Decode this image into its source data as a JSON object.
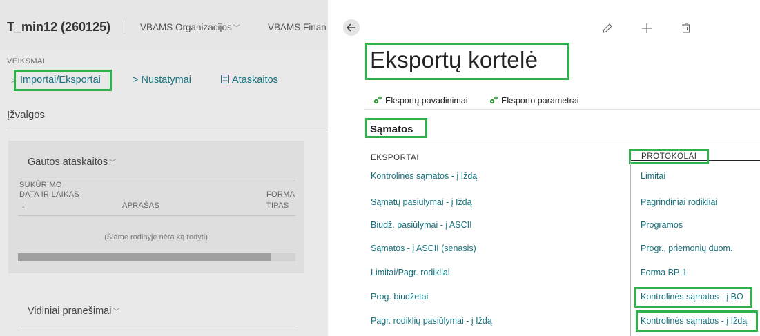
{
  "left_panel": {
    "app_title": "T_min12 (260125)",
    "nav": [
      {
        "label": "VBAMS Organizacijos",
        "icon": "chevron-down-icon"
      },
      {
        "label": "VBAMS Finan"
      }
    ],
    "actions_heading": "VEIKSMAI",
    "actions": [
      {
        "label": "Importai/Eksportai",
        "icon": "chevron-right-icon"
      },
      {
        "label": "> Nustatymai"
      },
      {
        "label": "Ataskaitos",
        "icon": "report-icon"
      }
    ],
    "insights_title": "Įžvalgos",
    "part_received": {
      "title": "Gautos ataskaitos",
      "columns": [
        "SUKŪRIMO",
        "DATA IR LAIKAS",
        "↓",
        "APRAŠAS",
        "FORMA",
        "TIPAS"
      ],
      "empty_message": "(Šiame rodinyje nėra ką rodyti)"
    },
    "part_internal": {
      "title": "Vidiniai pranešimai"
    }
  },
  "card": {
    "title": "Eksportų kortelė",
    "toolbar": {
      "names_label": "Eksportų pavadinimai",
      "params_label": "Eksporto parametrai"
    },
    "section_title": "Sąmatos",
    "exports_heading": "EKSPORTAI",
    "protocols_heading": "PROTOKOLAI",
    "exports": [
      "Kontrolinės sąmatos - į Iždą",
      "Sąmatų pasiūlymai - į Iždą",
      "Biudž. pasiūlymai - į ASCII",
      "Sąmatos - į ASCII (senasis)",
      "Limitai/Pagr. rodikliai",
      "Prog. biudžetai",
      "Pagr. rodiklių pasiūlymai - į Iždą"
    ],
    "protocols": [
      "Limitai",
      "Pagrindiniai rodikliai",
      "Programos",
      "Progr., priemonių duom.",
      "Forma BP-1",
      "Kontrolinės sąmatos - į BO",
      "Kontrolinės sąmatos - į Iždą"
    ]
  },
  "colors": {
    "link": "#15727e",
    "highlight": "#2fb24a"
  }
}
